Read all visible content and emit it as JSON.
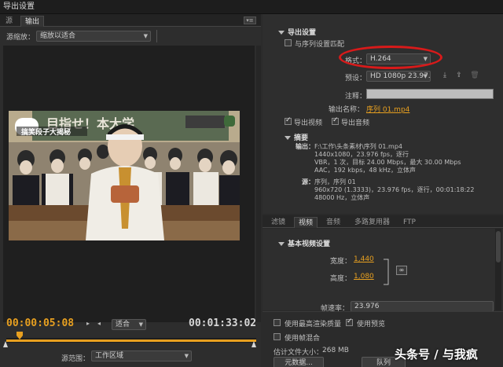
{
  "window": {
    "title": "导出设置"
  },
  "left": {
    "tabs": [
      "源",
      "输出"
    ],
    "source_scaling_label": "源缩放：",
    "source_scaling_value": "缩放以适合",
    "timecode_current": "00:00:05:08",
    "timecode_duration": "00:01:33:02",
    "fit_value": "适合",
    "source_range_label": "源范围：",
    "source_range_value": "工作区域",
    "timeline_progress": 0.055,
    "video": {
      "overlay_caption": "搞笑段子大揭秘",
      "blackboard_text": "目指せ！本大学"
    }
  },
  "export": {
    "section_title": "导出设置",
    "match_sequence_label": "与序列设置匹配",
    "format_label": "格式：",
    "format_value": "H.264",
    "preset_label": "预设：",
    "preset_value": "HD 1080p 23.97...",
    "comment_label": "注释：",
    "output_name_label": "输出名称：",
    "output_name_value": "序列 01.mp4",
    "export_video_label": "导出视频",
    "export_audio_label": "导出音频"
  },
  "summary": {
    "title": "摘要",
    "output_label": "输出：",
    "output_lines": [
      "F:\\工作\\头条素材\\序列 01.mp4",
      "1440x1080，23.976 fps，逐行",
      "VBR，1 次，目标 24.00 Mbps，最大 30.00 Mbps",
      "AAC，192 kbps，48 kHz，立体声"
    ],
    "source_label": "源：",
    "source_lines": [
      "序列，序列 01",
      "960x720 (1.3333)，23.976 fps，逐行，00:01:18:22",
      "48000 Hz，立体声"
    ]
  },
  "settings_tabs": [
    "滤镜",
    "视频",
    "音频",
    "多路复用器",
    "FTP"
  ],
  "basic_video": {
    "title": "基本视频设置",
    "width_label": "宽度：",
    "width_value": "1,440",
    "height_label": "高度：",
    "height_value": "1,080",
    "framerate_label": "帧速率：",
    "framerate_value": "23.976"
  },
  "bottom": {
    "max_render_label": "使用最高渲染质量",
    "use_preview_label": "使用预览",
    "frame_blend_label": "使用帧混合",
    "file_size_label": "估计文件大小：",
    "file_size_value": "268 MB",
    "metadata_button": "元数据...",
    "queue_button": "队列"
  },
  "watermark": "头条号 / 与我疯"
}
